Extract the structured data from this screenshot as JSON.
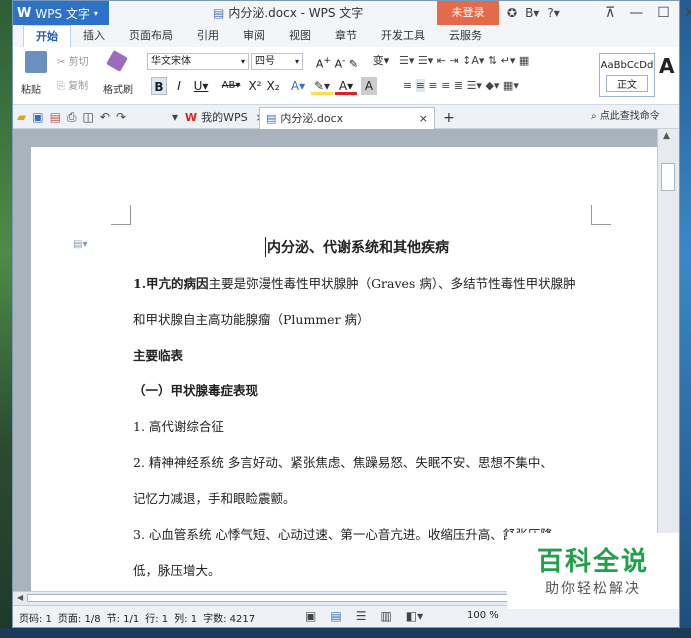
{
  "app": {
    "name": "WPS 文字",
    "doc_title": "内分泌.docx - WPS 文字",
    "login": "未登录",
    "help_label": "?"
  },
  "ribbon_tabs": [
    {
      "label": "开始",
      "active": true
    },
    {
      "label": "插入"
    },
    {
      "label": "页面布局"
    },
    {
      "label": "引用"
    },
    {
      "label": "审阅"
    },
    {
      "label": "视图"
    },
    {
      "label": "章节"
    },
    {
      "label": "开发工具"
    },
    {
      "label": "云服务"
    }
  ],
  "ribbon": {
    "paste": "粘贴",
    "cut": "剪切",
    "copy": "复制",
    "format_painter": "格式刷",
    "font_name": "华文宋体",
    "font_size": "四号",
    "style_sample": "AaBbCcDd",
    "style_name": "正文"
  },
  "doc_tabs": {
    "my_wps": "我的WPS",
    "current": "内分泌.docx",
    "search_command": "点此查找命令"
  },
  "document": {
    "title": "内分泌、代谢系统和其他疾病",
    "p1_bold": "1.甲亢的病因",
    "p1_rest": "主要是弥漫性毒性甲状腺肿（Graves 病）、多结节性毒性甲状腺肿",
    "p1_line2": "和甲状腺自主高功能腺瘤（Plummer 病）",
    "h2": "主要临表",
    "h3": "（一）甲状腺毒症表现",
    "l1": "1. 高代谢综合征",
    "l2": "2. 精神神经系统    多言好动、紧张焦虑、焦躁易怒、失眠不安、思想不集中、",
    "l2b": "记忆力减退，手和眼睑震颤。",
    "l3": "3. 心血管系统    心悸气短、心动过速、第一心音亢进。收缩压升高、舒张压降",
    "l3b": "低，脉压增大。"
  },
  "status": {
    "page_num": "页码: 1",
    "page": "页面: 1/8",
    "section": "节: 1/1",
    "row": "行: 1",
    "col": "列: 1",
    "words": "字数: 4217",
    "zoom": "100 %"
  },
  "watermark": {
    "main": "百科全说",
    "sub": "助你轻松解决"
  },
  "colors": {
    "accent": "#2e72c8",
    "login_bg": "#e36b4a",
    "watermark_green": "#22a04a"
  }
}
